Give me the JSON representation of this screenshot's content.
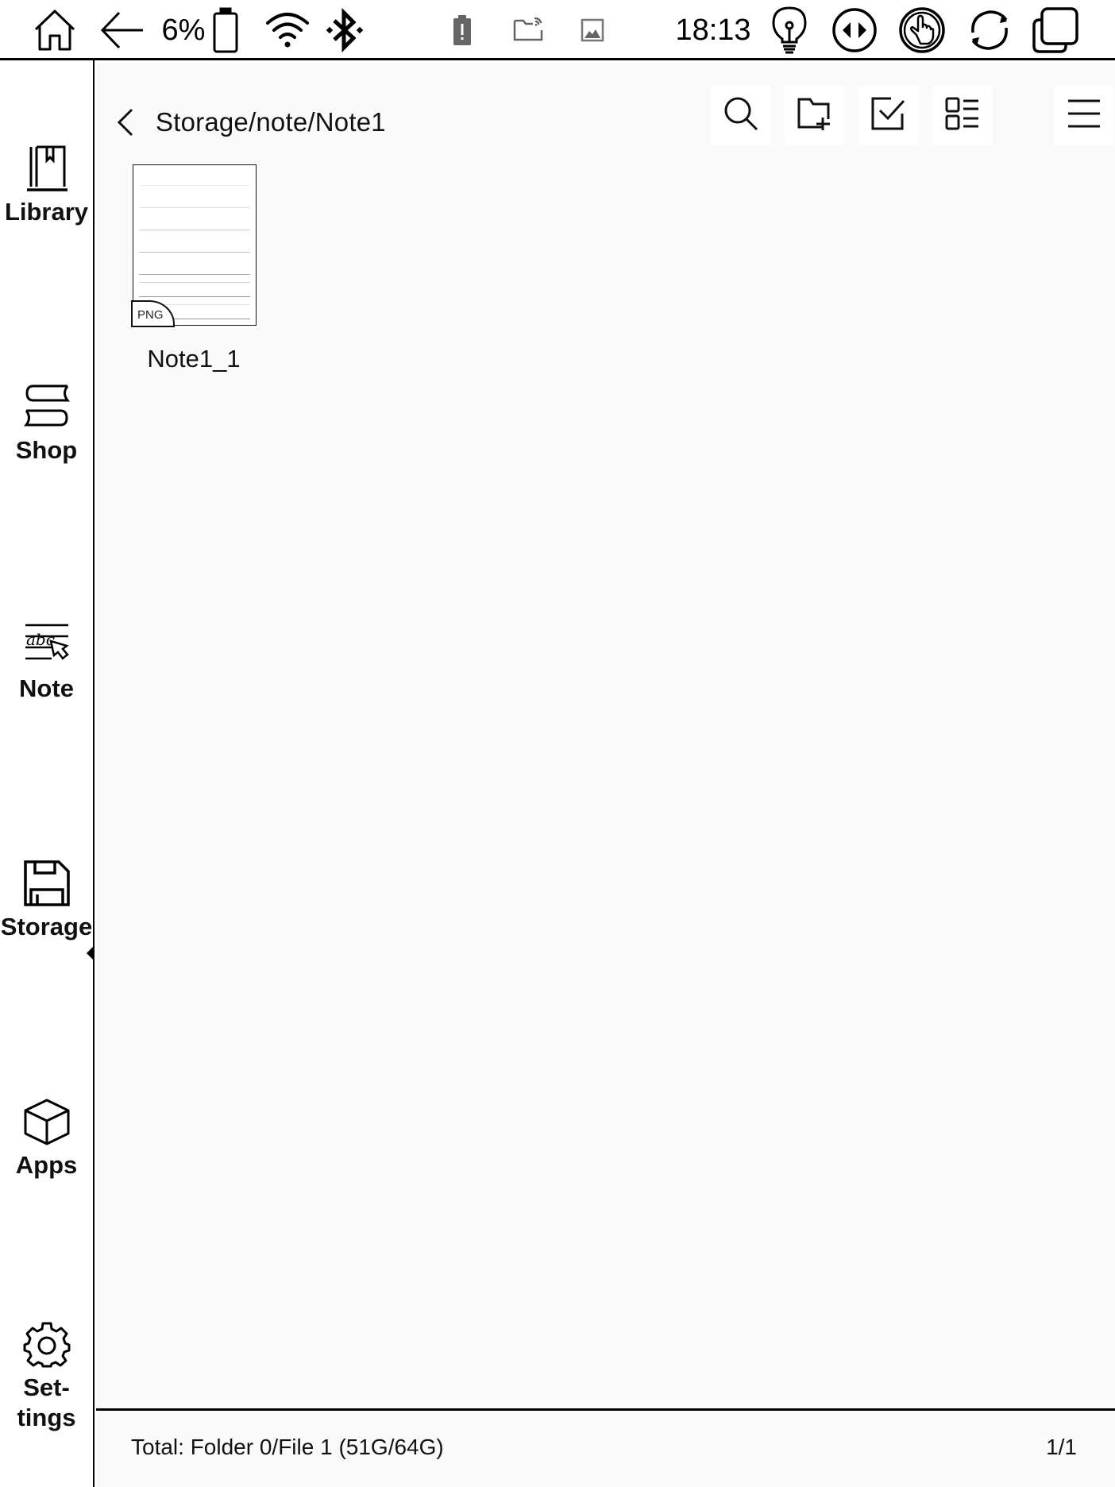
{
  "status_bar": {
    "battery_percent": "6%",
    "time": "18:13",
    "icons": {
      "home": "home-icon",
      "back": "back-arrow-icon",
      "battery": "battery-icon",
      "wifi": "wifi-icon",
      "bluetooth": "bluetooth-icon",
      "battery_alert": "battery-alert-notification-icon",
      "folder_cast": "folder-sync-notification-icon",
      "image": "image-notification-icon",
      "frontlight": "lightbulb-icon",
      "page_turn": "page-turn-icon",
      "touch": "touch-icon",
      "refresh": "refresh-icon",
      "multitask": "recent-apps-icon"
    }
  },
  "sidebar": {
    "items": [
      {
        "id": "library",
        "label": "Library",
        "icon": "library-book-icon"
      },
      {
        "id": "shop",
        "label": "Shop",
        "icon": "shop-books-icon"
      },
      {
        "id": "note",
        "label": "Note",
        "icon": "note-pen-icon"
      },
      {
        "id": "storage",
        "label": "Storage",
        "icon": "storage-floppy-icon",
        "active": true
      },
      {
        "id": "apps",
        "label": "Apps",
        "icon": "apps-cube-icon"
      },
      {
        "id": "settings",
        "label": "Set-\ntings",
        "icon": "gear-icon"
      }
    ]
  },
  "header": {
    "path": "Storage/note/Note1",
    "toolbar": [
      {
        "id": "search",
        "icon": "search-icon"
      },
      {
        "id": "new-folder",
        "icon": "new-folder-icon"
      },
      {
        "id": "select",
        "icon": "checkbox-icon"
      },
      {
        "id": "view-mode",
        "icon": "list-view-icon"
      },
      {
        "id": "menu",
        "icon": "menu-icon"
      }
    ]
  },
  "files": [
    {
      "name": "Note1_1",
      "type_badge": "PNG"
    }
  ],
  "footer": {
    "total": "Total:  Folder 0/File 1  (51G/64G)",
    "page": "1/1"
  }
}
